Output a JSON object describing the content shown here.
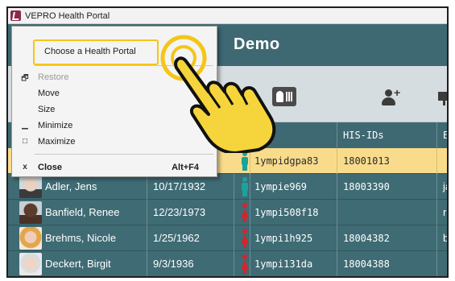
{
  "window": {
    "title": "VEPRO Health Portal"
  },
  "header": {
    "title": "Demo"
  },
  "toolbar": {
    "icons": [
      "contact-card-icon",
      "add-user-icon",
      "presentation-icon"
    ]
  },
  "table": {
    "columns": {
      "his_ids": "HIS-IDs",
      "email": "E-"
    },
    "rows": [
      {
        "name": "",
        "dob": "",
        "gender": "male",
        "id": "1ympidgpa83",
        "his": "18001013",
        "mail": "",
        "selected": true
      },
      {
        "name": "Adler, Jens",
        "dob": "10/17/1932",
        "gender": "male",
        "id": "1ympie969",
        "his": "18003390",
        "mail": "ja"
      },
      {
        "name": "Banfield, Renee",
        "dob": "12/23/1973",
        "gender": "female",
        "id": "1ympi508f18",
        "his": "",
        "mail": "re"
      },
      {
        "name": "Brehms, Nicole",
        "dob": "1/25/1962",
        "gender": "female",
        "id": "1ympi1h925",
        "his": "18004382",
        "mail": "br"
      },
      {
        "name": "Deckert, Birgit",
        "dob": "9/3/1936",
        "gender": "female",
        "id": "1ympi131da",
        "his": "18004388",
        "mail": ""
      }
    ]
  },
  "system_menu": {
    "items": [
      {
        "label": "Choose a Health Portal",
        "highlighted": true
      },
      {
        "label": "Restore",
        "glyph": "restore-icon",
        "disabled": true
      },
      {
        "label": "Move"
      },
      {
        "label": "Size"
      },
      {
        "label": "Minimize",
        "glyph": "minimize-icon"
      },
      {
        "label": "Maximize",
        "glyph": "maximize-icon"
      },
      {
        "label": "Close",
        "glyph": "close-icon",
        "accel": "Alt+F4"
      }
    ],
    "glyphs": {
      "restore": "🗗",
      "minimize": "▁",
      "maximize": "□",
      "close": "x"
    }
  },
  "colors": {
    "header": "#3e6972",
    "row": "#3f6b74",
    "selected_row": "#f8dc8c",
    "highlight": "#f5c518",
    "male": "#1aa39a",
    "female": "#d8232a"
  }
}
